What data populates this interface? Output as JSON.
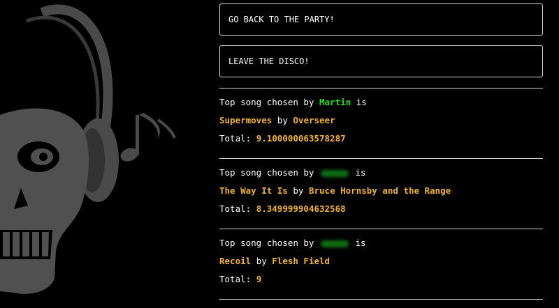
{
  "actions": {
    "back_label": "GO BACK TO THE PARTY!",
    "leave_label": "LEAVE THE DISCO!"
  },
  "labels": {
    "chosen_prefix": "Top song chosen by",
    "chosen_suffix": "is",
    "by": "by",
    "total": "Total:"
  },
  "entries": [
    {
      "chooser": "Martin",
      "chooser_visible": true,
      "song": "Supermoves",
      "artist": "Overseer",
      "total": "9.100000063578287"
    },
    {
      "chooser": "",
      "chooser_visible": false,
      "song": "The Way It Is",
      "artist": "Bruce Hornsby and the Range",
      "total": "8.349999904632568"
    },
    {
      "chooser": "",
      "chooser_visible": false,
      "song": "Recoil",
      "artist": "Flesh Field",
      "total": "9"
    }
  ],
  "colors": {
    "background": "#000000",
    "accent_song": "#f0b429",
    "accent_name": "#1ee11e",
    "skull": "#4a4a4a"
  }
}
